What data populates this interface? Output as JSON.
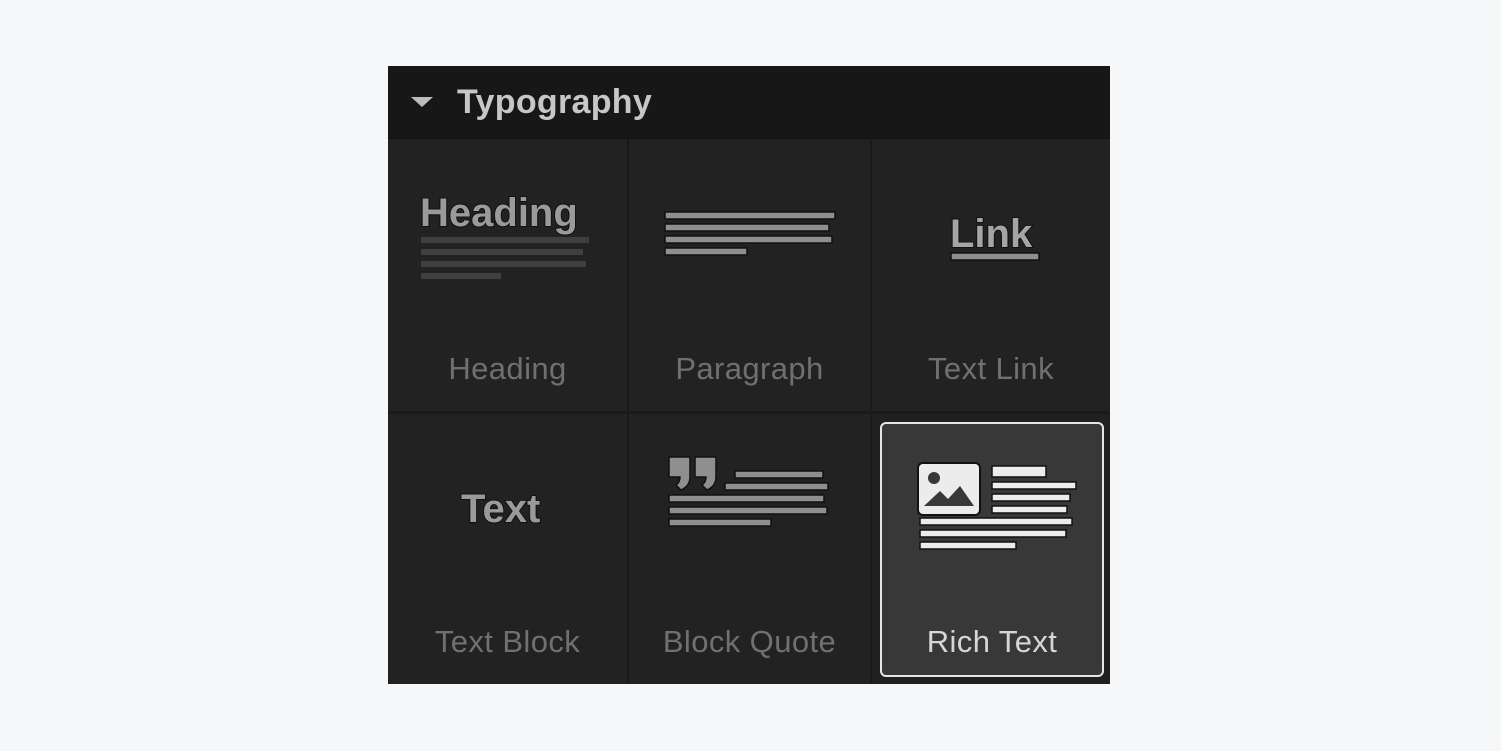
{
  "panel": {
    "title": "Typography",
    "colors": {
      "background": "#202020",
      "header": "#171717",
      "selected_border": "#e6e6e6",
      "selected_bg": "#383838"
    }
  },
  "items": [
    {
      "label": "Heading",
      "preview_text": "Heading",
      "icon": "heading-icon"
    },
    {
      "label": "Paragraph",
      "icon": "paragraph-icon"
    },
    {
      "label": "Text Link",
      "preview_text": "Link",
      "icon": "link-icon"
    },
    {
      "label": "Text Block",
      "preview_text": "Text",
      "icon": "text-block-icon"
    },
    {
      "label": "Block Quote",
      "icon": "block-quote-icon"
    },
    {
      "label": "Rich Text",
      "icon": "rich-text-icon",
      "selected": true
    }
  ]
}
